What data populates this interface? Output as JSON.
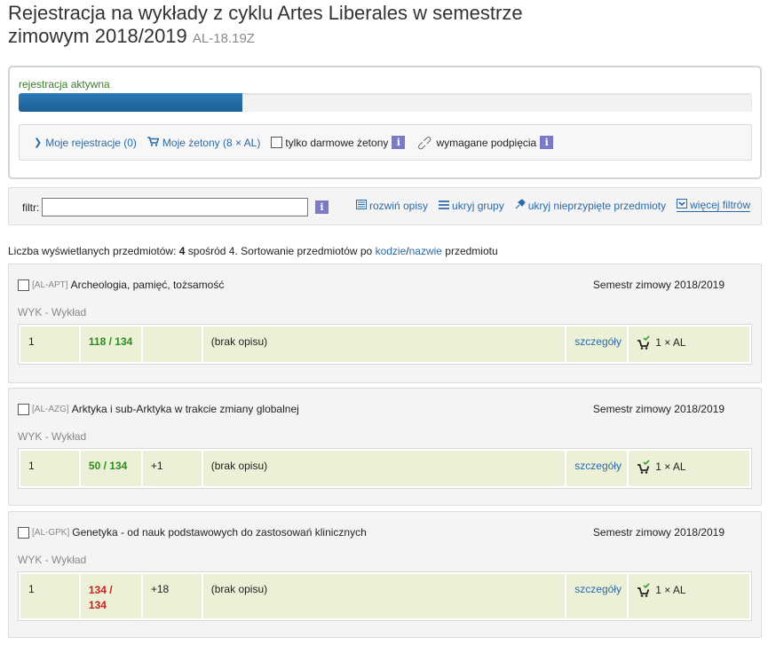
{
  "header": {
    "title": "Rejestracja na wykłady z cyklu Artes Liberales w semestrze zimowym 2018/2019",
    "code": "AL-18.19Z"
  },
  "registration": {
    "status": "rejestracja aktywna",
    "progress": 0.305,
    "my_registrations": "Moje rejestracje (0)",
    "my_tokens": "Moje żetony (8 × AL)",
    "free_tokens_only": "tylko darmowe żetony",
    "required_links": "wymagane podpięcia"
  },
  "filter": {
    "label": "filtr:",
    "input_value": "",
    "actions": [
      "rozwiń opisy",
      "ukryj grupy",
      "ukryj nieprzypięte przedmioty",
      "więcej filtrów"
    ]
  },
  "count": {
    "prefix": "Liczba wyświetlanych przedmiotów: ",
    "shown": "4",
    "middle": " spośród 4. Sortowanie przedmiotów po ",
    "sort_code": "kodzie",
    "slash": "/",
    "sort_name": "nazwie",
    "suffix": " przedmiotu"
  },
  "courses": [
    {
      "code": "[AL-APT]",
      "name": "Archeologia, pamięć, tożsamość",
      "semester": "Semestr zimowy 2018/2019",
      "type": "WYK - Wykład",
      "group": "1",
      "seats_line1": "118 / 134",
      "seats_line2": "",
      "extra": "",
      "description": "(brak opisu)",
      "details": "szczegóły",
      "cost": "1 × AL"
    },
    {
      "code": "[AL-AZG]",
      "name": "Arktyka i sub-Arktyka w trakcie zmiany globalnej",
      "semester": "Semestr zimowy 2018/2019",
      "type": "WYK - Wykład",
      "group": "1",
      "seats_line1": "50 / 134",
      "seats_line2": "",
      "extra": "+1",
      "description": "(brak opisu)",
      "details": "szczegóły",
      "cost": "1 × AL"
    },
    {
      "code": "[AL-GPK]",
      "name": "Genetyka - od nauk podstawowych do zastosowań klinicznych",
      "semester": "Semestr zimowy 2018/2019",
      "type": "WYK - Wykład",
      "group": "1",
      "seats_line1": "134 /",
      "seats_line2": "134",
      "extra": "+18",
      "description": "(brak opisu)",
      "details": "szczegóły",
      "cost": "1 × AL"
    }
  ],
  "colors": {
    "accent": "#2a6aa8",
    "progress": "#1d5f95",
    "seats_ok": "#2a8f1a",
    "seats_full": "#d01e1e",
    "cell_bg": "#ecf0d6"
  }
}
